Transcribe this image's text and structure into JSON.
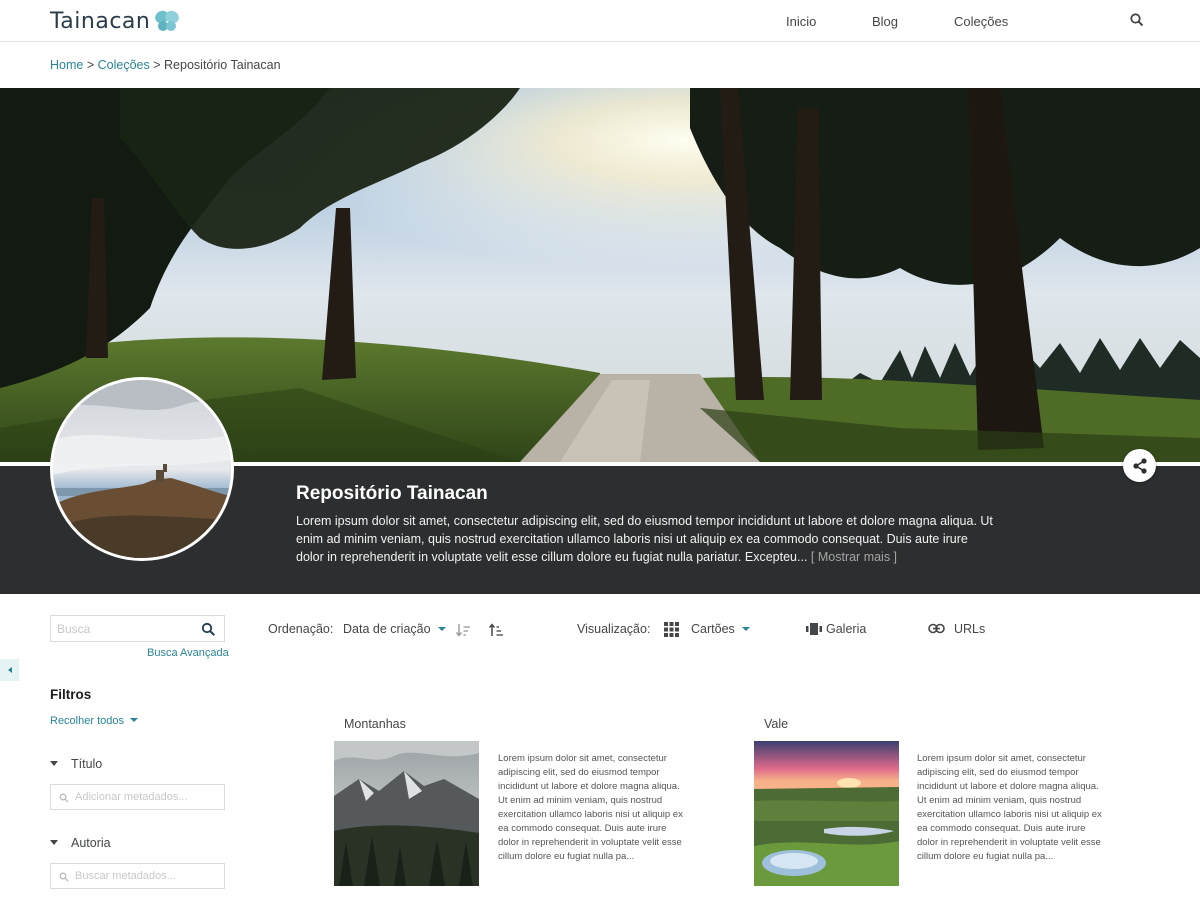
{
  "app": {
    "logo_text": "Tainacan",
    "logo_icon": "butterfly-logo-icon",
    "brand_color": "#298596"
  },
  "nav": {
    "items": [
      "Inicio",
      "Blog",
      "Coleções"
    ],
    "search_icon": "search-icon"
  },
  "breadcrumb": {
    "home": "Home",
    "collections": "Coleções",
    "current": "Repositório Tainacan",
    "separator": ">"
  },
  "collection": {
    "title": "Repositório Tainacan",
    "description": "Lorem ipsum dolor sit amet, consectetur adipiscing elit, sed do eiusmod tempor incididunt ut labore et dolore magna aliqua. Ut enim ad minim veniam, quis nostrud exercitation ullamco laboris nisi ut aliquip ex ea commodo consequat. Duis aute irure dolor in reprehenderit in voluptate velit esse cillum dolore eu fugiat nulla pariatur. Excepteu...",
    "show_more": "[ Mostrar mais ]",
    "share_icon": "share-icon",
    "band_color": "#2d2e2f"
  },
  "search": {
    "placeholder": "Busca",
    "advanced": "Busca Avançada"
  },
  "filters": {
    "title": "Filtros",
    "collapse_all": "Recolher todos",
    "facets": [
      {
        "label": "Título",
        "placeholder": "Adicionar metadados..."
      },
      {
        "label": "Autoria",
        "placeholder": "Buscar metadados..."
      }
    ]
  },
  "controls": {
    "sort_label": "Ordenação:",
    "sort_value": "Data de criação",
    "view_label": "Visualização:",
    "view_modes": [
      "Cartões",
      "Galeria",
      "URLs"
    ],
    "active_view": "Cartões"
  },
  "items": [
    {
      "title": "Montanhas",
      "description": "Lorem ipsum dolor sit amet, consectetur adipiscing elit, sed do eiusmod tempor incididunt ut labore et dolore magna aliqua. Ut enim ad minim veniam, quis nostrud exercitation ullamco laboris nisi ut aliquip ex ea commodo consequat. Duis aute irure dolor in reprehenderit in voluptate velit esse cillum dolore eu fugiat nulla pa..."
    },
    {
      "title": "Vale",
      "description": "Lorem ipsum dolor sit amet, consectetur adipiscing elit, sed do eiusmod tempor incididunt ut labore et dolore magna aliqua. Ut enim ad minim veniam, quis nostrud exercitation ullamco laboris nisi ut aliquip ex ea commodo consequat. Duis aute irure dolor in reprehenderit in voluptate velit esse cillum dolore eu fugiat nulla pa..."
    }
  ]
}
